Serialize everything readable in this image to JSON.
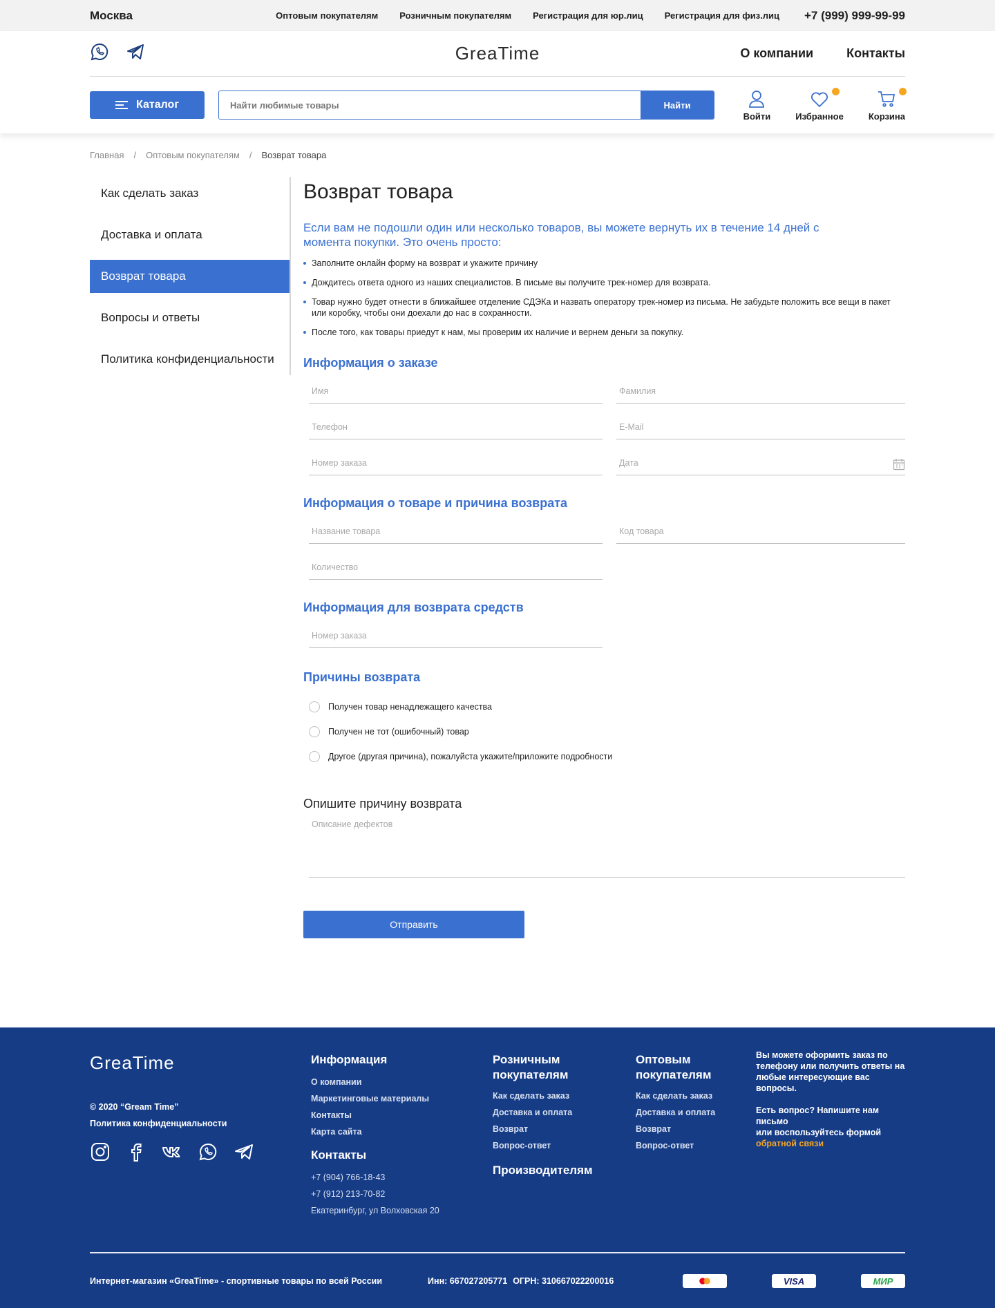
{
  "topbar": {
    "city": "Москва",
    "links": [
      "Оптовым покупателям",
      "Розничным покупателям",
      "Регистрация для юр.лиц",
      "Регистрация для физ.лиц"
    ],
    "phone": "+7 (999) 999-99-99"
  },
  "header": {
    "logo": "GreaTime",
    "nav": [
      "О компании",
      "Контакты"
    ],
    "catalog_label": "Каталог",
    "search_placeholder": "Найти любимые товары",
    "search_button": "Найти",
    "icons": [
      {
        "label": "Войти",
        "icon": "user-icon"
      },
      {
        "label": "Избранное",
        "icon": "heart-icon",
        "badge": true
      },
      {
        "label": "Корзина",
        "icon": "cart-icon",
        "badge": true
      }
    ],
    "accent_color": "#3a70cf",
    "badge_color": "#f5a623"
  },
  "breadcrumb": [
    "Главная",
    "Оптовым покупателям",
    "Возврат товара"
  ],
  "sidebar": {
    "items": [
      "Как сделать заказ",
      "Доставка и оплата",
      "Возврат товара",
      "Вопросы и ответы",
      "Политика конфиденциальности"
    ],
    "active": "Возврат товара"
  },
  "main": {
    "title": "Возврат товара",
    "lead": "Если вам не подошли один или несколько товаров, вы можете вернуть их в течение 14 дней с момента покупки. Это очень просто:",
    "steps": [
      "Заполните онлайн форму на возврат и укажите причину",
      "Дождитесь ответа одного из наших специалистов. В письме вы получите трек-номер для возврата.",
      "Товар нужно будет отнести в ближайшее отделение СДЭКа и назвать оператору трек-номер из письма. Не забудьте положить все вещи в пакет или коробку, чтобы они доехали до нас в сохранности.",
      "После того, как товары приедут к нам, мы проверим их наличие и вернем деньги за покупку."
    ],
    "order_info": {
      "heading": "Информация о заказе",
      "first_name": "Имя",
      "last_name": "Фамилия",
      "phone": "Телефон",
      "email": "E-Mail",
      "order_number": "Номер заказа",
      "date": "Дата"
    },
    "product_info": {
      "heading": "Информация о товаре и причина возврата",
      "product_name": "Название товара",
      "product_code": "Код товара",
      "quantity": "Количество"
    },
    "refund_info": {
      "heading": "Информация для возврата средств",
      "order_number": "Номер заказа"
    },
    "reasons": {
      "heading": "Причины возврата",
      "options": [
        "Получен товар ненадлежащего качества",
        "Получен не тот (ошибочный) товар",
        "Другое (другая причина), пожалуйста укажите/приложите подробности"
      ]
    },
    "description": {
      "heading": "Опишите причину возврата",
      "placeholder": "Описание дефектов"
    },
    "submit": "Отправить"
  },
  "footer": {
    "logo": "GreaTime",
    "copyright": "© 2020 “Gream Time”",
    "privacy": "Политика конфиденциальности",
    "social_icons": [
      "instagram-icon",
      "facebook-icon",
      "vk-icon",
      "whatsapp-icon",
      "telegram-icon"
    ],
    "info": {
      "heading": "Информация",
      "links": [
        "О компании",
        "Маркетинговые материалы",
        "Контакты",
        "Карта сайта"
      ]
    },
    "contacts": {
      "heading": "Контакты",
      "phone1": "+7 (904) 766-18-43",
      "phone2": "+7 (912) 213-70-82",
      "address": "Екатеринбург, ул Волховская 20"
    },
    "retail": {
      "heading": "Розничным покупателям",
      "links": [
        "Как сделать заказ",
        "Доставка и оплата",
        "Возврат",
        "Вопрос-ответ"
      ]
    },
    "manufacturers": "Производителям",
    "wholesale": {
      "heading": "Оптовым покупателям",
      "links": [
        "Как сделать заказ",
        "Доставка и оплата",
        "Возврат",
        "Вопрос-ответ"
      ]
    },
    "help_text": "Вы можете оформить заказ по телефону или получить ответы на любые интересующие вас вопросы.",
    "question_text": "Есть вопрос? Напишите нам письмо",
    "feedback_prefix": "или воспользуйтесь формой",
    "feedback_link": "обратной связи",
    "shop_text": "Интернет-магазин «GreaTime» - спортивные товары по всей России",
    "inn": "Инн:  667027205771",
    "ogrn": "ОГРН: 310667022200016",
    "payments": [
      "mastercard",
      "VISA",
      "МИР"
    ],
    "bg_color": "#163c86"
  }
}
